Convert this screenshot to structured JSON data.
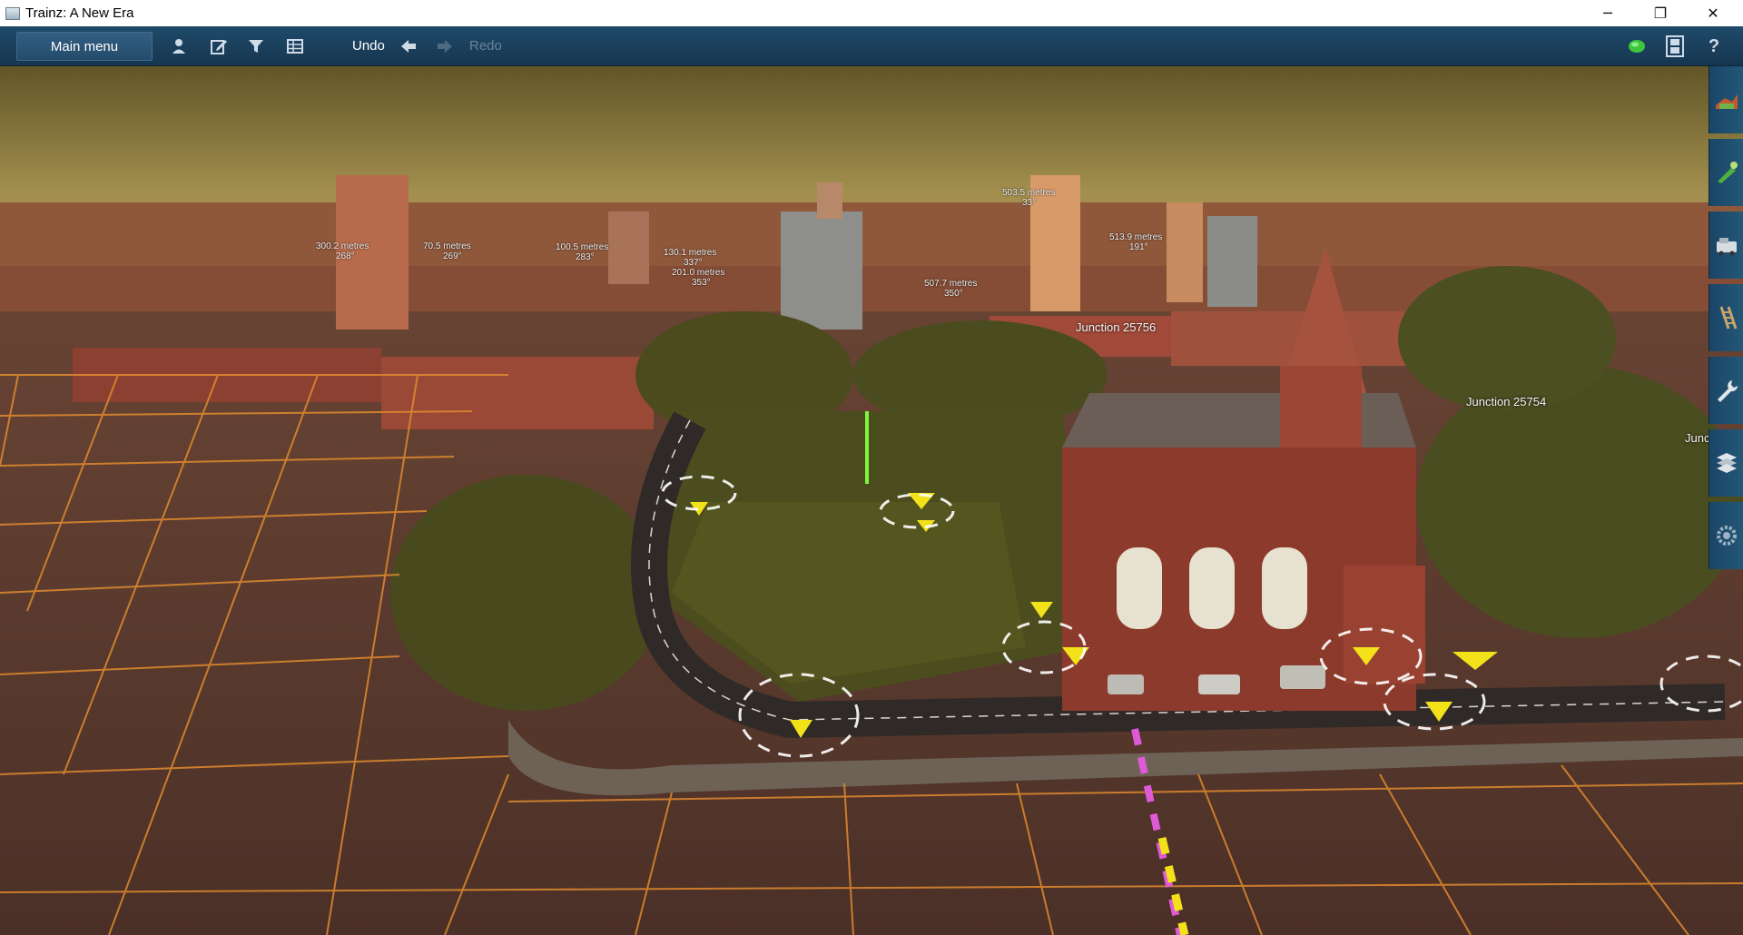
{
  "window": {
    "title": "Trainz: A New Era",
    "minimize": "─",
    "maximize": "❐",
    "close": "✕"
  },
  "toolbar": {
    "main_menu": "Main menu",
    "undo": "Undo",
    "redo": "Redo",
    "icons": [
      "driver-icon",
      "edit-icon",
      "filter-icon",
      "grid-table-icon",
      "undo-arrow-icon",
      "redo-arrow-icon",
      "status-dot-icon",
      "film-strip-icon",
      "help-icon"
    ],
    "help": "?",
    "status_color": "#3ec53e"
  },
  "scene": {
    "distance_labels": [
      {
        "text": "300.2 metres",
        "sub": "268°"
      },
      {
        "text": "70.5 metres",
        "sub": "269°"
      },
      {
        "text": "100.5 metres",
        "sub": "283°"
      },
      {
        "text": "130.1 metres",
        "sub": "337°"
      },
      {
        "text": "201.0 metres",
        "sub": "353°"
      },
      {
        "text": "503.5 metres",
        "sub": "33°"
      },
      {
        "text": "513.9 metres",
        "sub": "191°"
      },
      {
        "text": "507.7 metres",
        "sub": "350°"
      }
    ],
    "junctions": [
      "Junction 25756",
      "Junction 25754",
      "Junc"
    ]
  },
  "sidebar": {
    "tools": [
      "topology-tool-icon",
      "paint-tool-icon",
      "objects-tool-icon",
      "track-tool-icon",
      "tools-wrench-icon",
      "layers-icon",
      "settings-gear-icon"
    ]
  },
  "colors": {
    "grid": "#e08a2e",
    "toolbar": "#1c4262",
    "marker": "#f3e21a"
  }
}
